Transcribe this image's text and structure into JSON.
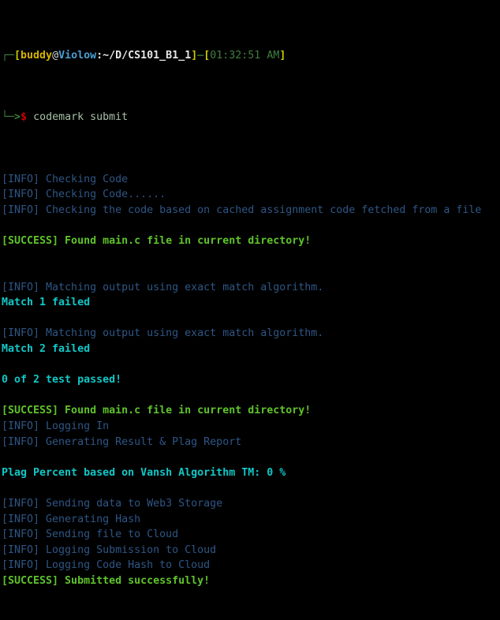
{
  "terminal": {
    "background_color": "#000000",
    "prompt": {
      "connector_top": "┌─",
      "connector_bottom": "└─>",
      "open_bracket": "[",
      "user": "buddy",
      "at": "@",
      "host": "Violow",
      "path": ":~/D/CS101_B1_1",
      "close_bracket": "]",
      "separator": "–",
      "time_open_bracket": "[",
      "time": "01:32:51 AM",
      "time_close_bracket": "]",
      "dollar": "$",
      "command": "codemark submit"
    },
    "colors": {
      "info": "#2e5685",
      "success": "#5fc32a",
      "cyan": "#11c7c7",
      "user": "#d7b300",
      "host": "#4a9fd4",
      "bracket": "#c9c900",
      "dollar": "#cc0000",
      "time": "#3f7f3f"
    },
    "output_lines": [
      {
        "type": "info",
        "text": "[INFO] Checking Code"
      },
      {
        "type": "info",
        "text": "[INFO] Checking Code......"
      },
      {
        "type": "info",
        "text": "[INFO] Checking the code based on cached assignment code fetched from a file"
      },
      {
        "type": "blank",
        "text": ""
      },
      {
        "type": "success",
        "text": "[SUCCESS] Found main.c file in current directory!"
      },
      {
        "type": "blank",
        "text": ""
      },
      {
        "type": "blank",
        "text": ""
      },
      {
        "type": "info",
        "text": "[INFO] Matching output using exact match algorithm."
      },
      {
        "type": "cyan",
        "text": "Match 1 failed"
      },
      {
        "type": "blank",
        "text": ""
      },
      {
        "type": "info",
        "text": "[INFO] Matching output using exact match algorithm."
      },
      {
        "type": "cyan",
        "text": "Match 2 failed"
      },
      {
        "type": "blank",
        "text": ""
      },
      {
        "type": "cyan",
        "text": "0 of 2 test passed!"
      },
      {
        "type": "blank",
        "text": ""
      },
      {
        "type": "success",
        "text": "[SUCCESS] Found main.c file in current directory!"
      },
      {
        "type": "info",
        "text": "[INFO] Logging In"
      },
      {
        "type": "info",
        "text": "[INFO] Generating Result & Plag Report"
      },
      {
        "type": "blank",
        "text": ""
      },
      {
        "type": "cyan",
        "text": "Plag Percent based on Vansh Algorithm TM: 0 %"
      },
      {
        "type": "blank",
        "text": ""
      },
      {
        "type": "info",
        "text": "[INFO] Sending data to Web3 Storage"
      },
      {
        "type": "info",
        "text": "[INFO] Generating Hash"
      },
      {
        "type": "info",
        "text": "[INFO] Sending file to Cloud"
      },
      {
        "type": "info",
        "text": "[INFO] Logging Submission to Cloud"
      },
      {
        "type": "info",
        "text": "[INFO] Logging Code Hash to Cloud"
      },
      {
        "type": "success",
        "text": "[SUCCESS] Submitted successfully!"
      }
    ]
  }
}
